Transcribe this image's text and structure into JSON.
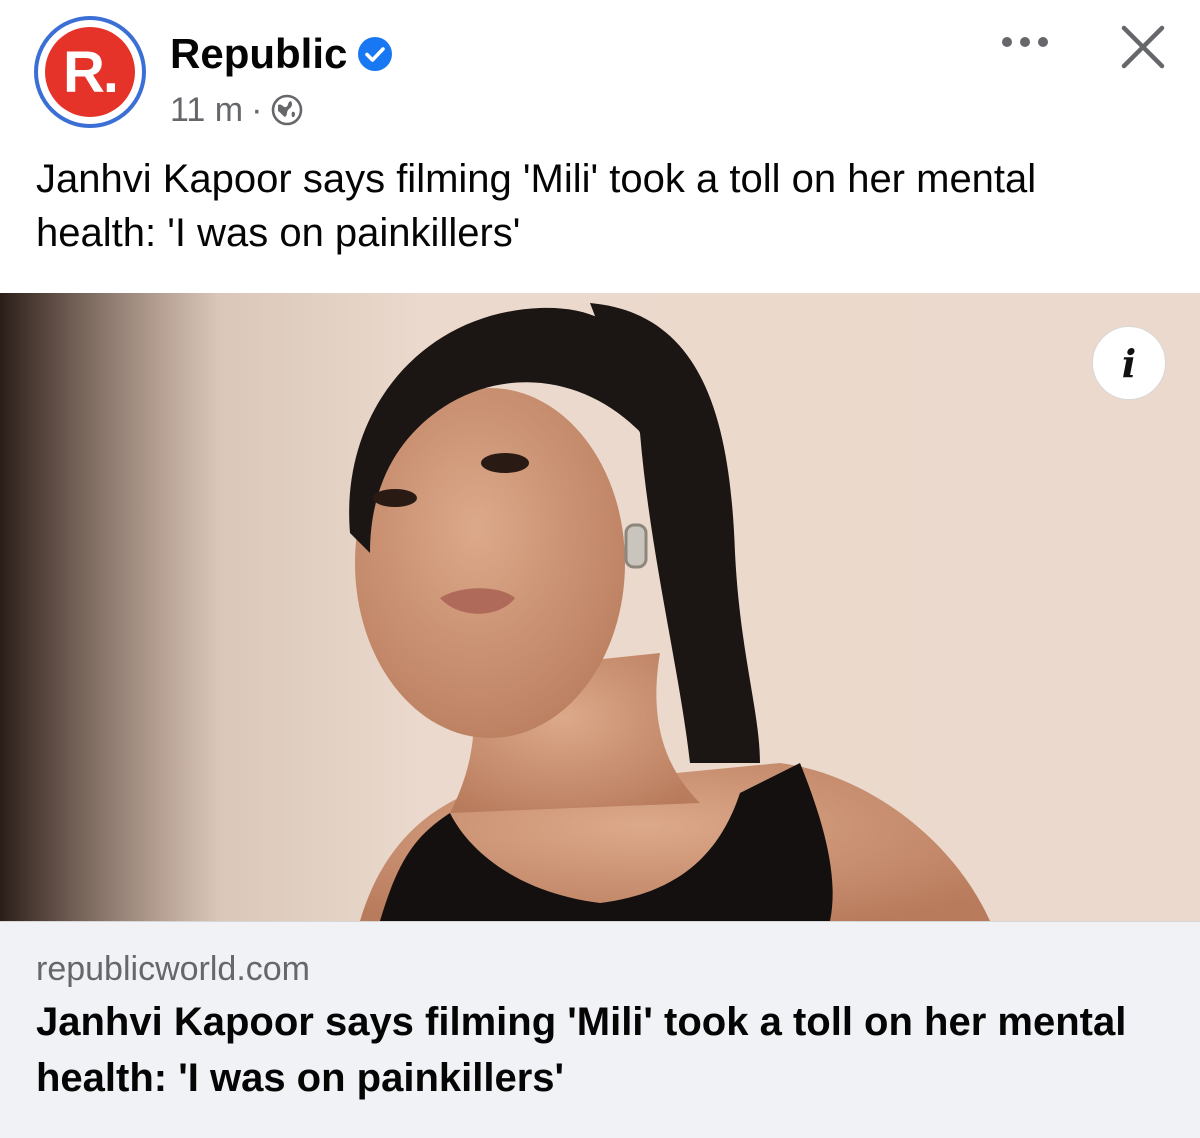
{
  "post": {
    "page_name": "Republic",
    "avatar_letter": "R.",
    "time": "11 m",
    "separator": "·",
    "audience_icon": "globe-icon",
    "verified_icon": "verified-badge-icon",
    "more_icon": "more-options-icon",
    "close_icon": "close-icon",
    "caption": "Janhvi Kapoor says filming 'Mili' took a toll on her mental health: 'I was on painkillers'"
  },
  "media": {
    "info_label": "i"
  },
  "link_preview": {
    "domain": "republicworld.com",
    "title": "Janhvi Kapoor says filming 'Mili' took a toll on her mental health: 'I was on painkillers'"
  },
  "colors": {
    "brand_red": "#e5332a",
    "verified_blue": "#1877f2",
    "meta_gray": "#65676b",
    "preview_bg": "#f0f2f5"
  }
}
